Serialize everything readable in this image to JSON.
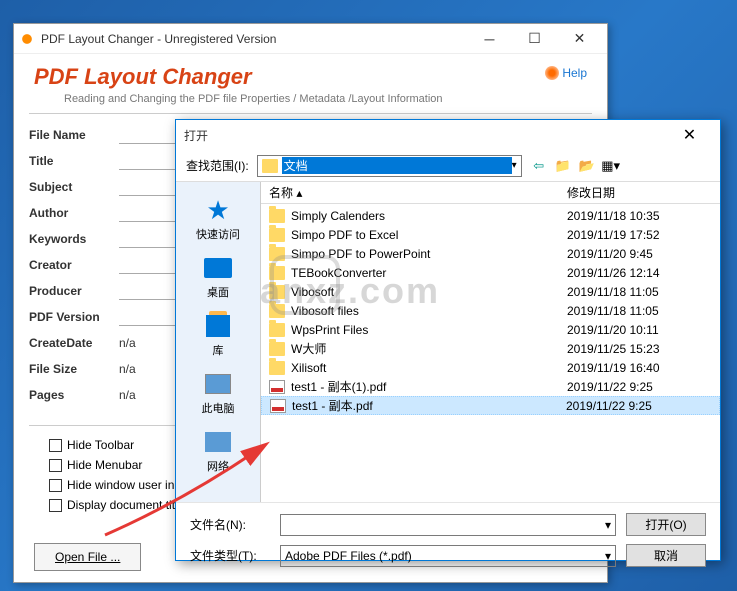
{
  "main": {
    "title": "PDF Layout Changer - Unregistered Version",
    "app_title": "PDF Layout Changer",
    "subtitle": "Reading and Changing the PDF file Properties / Metadata /Layout Information",
    "help": "Help",
    "labels": {
      "filename": "File Name",
      "title": "Title",
      "subject": "Subject",
      "author": "Author",
      "keywords": "Keywords",
      "creator": "Creator",
      "producer": "Producer",
      "pdfversion": "PDF Version",
      "createdate": "CreateDate",
      "filesize": "File Size",
      "pages": "Pages"
    },
    "values": {
      "createdate": "n/a",
      "filesize": "n/a",
      "pages": "n/a"
    },
    "checks": {
      "hide_toolbar": "Hide Toolbar",
      "hide_menubar": "Hide Menubar",
      "hide_window": "Hide window user in",
      "display_doc": "Display document tit"
    },
    "open_btn": "Open File ..."
  },
  "dialog": {
    "title": "打开",
    "range_label": "查找范围(I):",
    "location": "文档",
    "col_name": "名称",
    "col_date": "修改日期",
    "sidebar": {
      "quick": "快速访问",
      "desktop": "桌面",
      "lib": "库",
      "pc": "此电脑",
      "net": "网络"
    },
    "files": [
      {
        "name": "Simply Calenders",
        "date": "2019/11/18 10:35",
        "type": "folder"
      },
      {
        "name": "Simpo PDF to Excel",
        "date": "2019/11/19 17:52",
        "type": "folder"
      },
      {
        "name": "Simpo PDF to PowerPoint",
        "date": "2019/11/20 9:45",
        "type": "folder"
      },
      {
        "name": "TEBookConverter",
        "date": "2019/11/26 12:14",
        "type": "folder"
      },
      {
        "name": "Vibosoft",
        "date": "2019/11/18 11:05",
        "type": "folder"
      },
      {
        "name": "Vibosoft files",
        "date": "2019/11/18 11:05",
        "type": "folder"
      },
      {
        "name": "WpsPrint Files",
        "date": "2019/11/20 10:11",
        "type": "folder"
      },
      {
        "name": "W大师",
        "date": "2019/11/25 15:23",
        "type": "folder"
      },
      {
        "name": "Xilisoft",
        "date": "2019/11/19 16:40",
        "type": "folder"
      },
      {
        "name": "test1 - 副本(1).pdf",
        "date": "2019/11/22 9:25",
        "type": "pdf"
      },
      {
        "name": "test1 - 副本.pdf",
        "date": "2019/11/22 9:25",
        "type": "pdf",
        "selected": true
      }
    ],
    "filename_label": "文件名(N):",
    "filetype_label": "文件类型(T):",
    "filetype_value": "Adobe PDF Files (*.pdf)",
    "open_btn": "打开(O)",
    "cancel_btn": "取消"
  },
  "watermark": "anxz.com"
}
